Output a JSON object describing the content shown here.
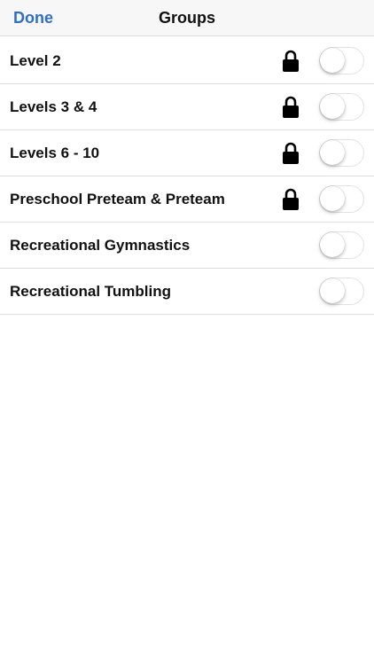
{
  "navbar": {
    "done_label": "Done",
    "title": "Groups"
  },
  "colors": {
    "accent": "#2f6fc5",
    "separator": "#dedede",
    "toggle_off_border": "#e3e3e3"
  },
  "groups": [
    {
      "label": "Level 2",
      "locked": true,
      "enabled": false
    },
    {
      "label": "Levels 3 & 4",
      "locked": true,
      "enabled": false
    },
    {
      "label": "Levels 6 - 10",
      "locked": true,
      "enabled": false
    },
    {
      "label": "Preschool Preteam & Preteam",
      "locked": true,
      "enabled": false
    },
    {
      "label": "Recreational Gymnastics",
      "locked": false,
      "enabled": false
    },
    {
      "label": "Recreational Tumbling",
      "locked": false,
      "enabled": false
    }
  ]
}
